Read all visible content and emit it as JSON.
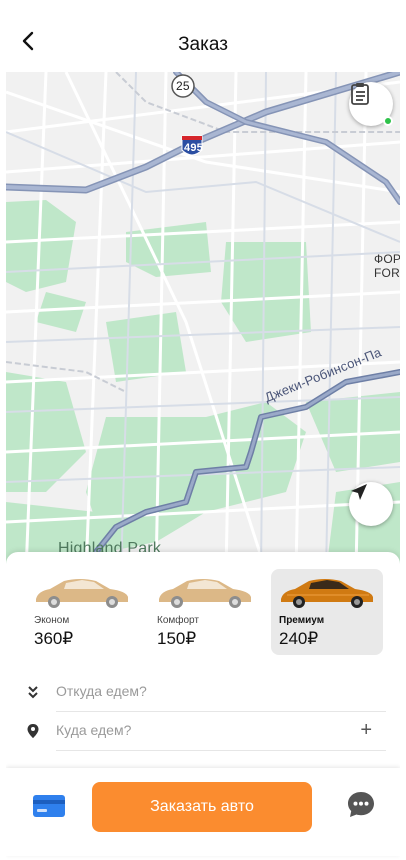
{
  "header": {
    "title": "Заказ"
  },
  "map": {
    "highway_shield": "495",
    "route_shield": "25",
    "label_road": "Джеки-Робинсон-Па",
    "label_park": "Highland Park",
    "label_edge_1": "ФОР",
    "label_edge_2": "FOR"
  },
  "tariffs": [
    {
      "name": "Эконом",
      "price": "360₽",
      "color": "#d9b07a",
      "selected": false
    },
    {
      "name": "Комфорт",
      "price": "150₽",
      "color": "#d9b07a",
      "selected": false
    },
    {
      "name": "Премиум",
      "price": "240₽",
      "color": "#d07a12",
      "selected": true
    }
  ],
  "route": {
    "from_placeholder": "Откуда едем?",
    "to_placeholder": "Куда едем?",
    "add_label": "+"
  },
  "bottom_bar": {
    "order_label": "Заказать авто"
  },
  "colors": {
    "accent": "#fb8c2f",
    "card": "#2f80ed",
    "chat": "#555555",
    "status_dot": "#2ec24a"
  },
  "icons": [
    "back-arrow-icon",
    "orders-list-icon",
    "navigation-arrow-icon",
    "double-chevron-down-icon",
    "location-pin-icon",
    "credit-card-icon",
    "chat-bubble-icon"
  ]
}
